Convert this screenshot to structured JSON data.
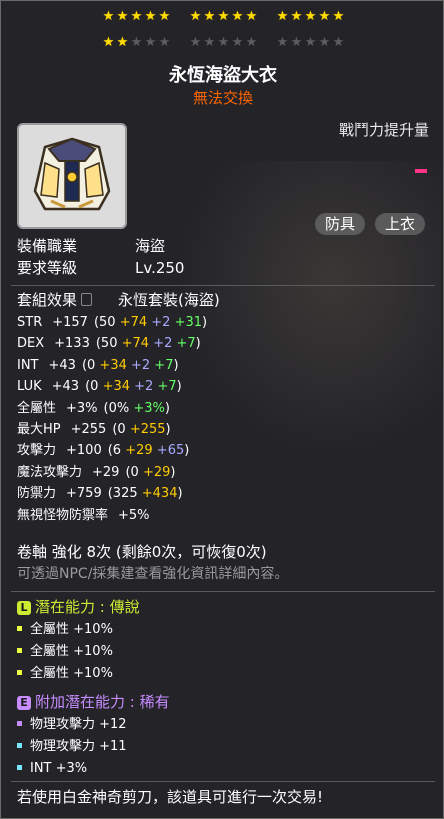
{
  "stars": {
    "rows": [
      [
        5,
        5,
        5
      ],
      [
        2,
        0,
        0
      ]
    ],
    "per_group": 5
  },
  "item": {
    "name": "永恆海盜大衣",
    "trade_status": "無法交換"
  },
  "power": {
    "label": "戰鬥力提升量"
  },
  "tags": [
    "防具",
    "上衣"
  ],
  "requirements": [
    {
      "label": "裝備職業",
      "value": "海盜"
    },
    {
      "label": "要求等級",
      "value": "Lv.250"
    }
  ],
  "set_effect": {
    "label": "套組效果",
    "value": "永恆套裝(海盜)"
  },
  "stats": [
    {
      "name": "STR",
      "total": "+157",
      "parts": [
        {
          "text": "(50 ",
          "c": ""
        },
        {
          "text": "+74 ",
          "c": "yellow"
        },
        {
          "text": "+2 ",
          "c": "purple"
        },
        {
          "text": "+31",
          "c": "green"
        },
        {
          "text": ")",
          "c": ""
        }
      ]
    },
    {
      "name": "DEX",
      "total": "+133",
      "parts": [
        {
          "text": "(50 ",
          "c": ""
        },
        {
          "text": "+74 ",
          "c": "yellow"
        },
        {
          "text": "+2 ",
          "c": "purple"
        },
        {
          "text": "+7",
          "c": "green"
        },
        {
          "text": ")",
          "c": ""
        }
      ]
    },
    {
      "name": "INT",
      "total": "+43",
      "parts": [
        {
          "text": "(0 ",
          "c": ""
        },
        {
          "text": "+34 ",
          "c": "yellow"
        },
        {
          "text": "+2 ",
          "c": "purple"
        },
        {
          "text": "+7",
          "c": "green"
        },
        {
          "text": ")",
          "c": ""
        }
      ]
    },
    {
      "name": "LUK",
      "total": "+43",
      "parts": [
        {
          "text": "(0 ",
          "c": ""
        },
        {
          "text": "+34 ",
          "c": "yellow"
        },
        {
          "text": "+2 ",
          "c": "purple"
        },
        {
          "text": "+7",
          "c": "green"
        },
        {
          "text": ")",
          "c": ""
        }
      ]
    },
    {
      "name": "全屬性",
      "total": "+3%",
      "parts": [
        {
          "text": "(0% ",
          "c": ""
        },
        {
          "text": "+3%",
          "c": "green"
        },
        {
          "text": ")",
          "c": ""
        }
      ]
    },
    {
      "name": "最大HP",
      "total": "+255",
      "parts": [
        {
          "text": "(0 ",
          "c": ""
        },
        {
          "text": "+255",
          "c": "yellow"
        },
        {
          "text": ")",
          "c": ""
        }
      ]
    },
    {
      "name": "攻擊力",
      "total": "+100",
      "parts": [
        {
          "text": "(6 ",
          "c": ""
        },
        {
          "text": "+29 ",
          "c": "yellow"
        },
        {
          "text": "+65",
          "c": "purple"
        },
        {
          "text": ")",
          "c": ""
        }
      ]
    },
    {
      "name": "魔法攻擊力",
      "total": "+29",
      "parts": [
        {
          "text": "(0 ",
          "c": ""
        },
        {
          "text": "+29",
          "c": "yellow"
        },
        {
          "text": ")",
          "c": ""
        }
      ]
    },
    {
      "name": "防禦力",
      "total": "+759",
      "parts": [
        {
          "text": "(325 ",
          "c": ""
        },
        {
          "text": "+434",
          "c": "yellow"
        },
        {
          "text": ")",
          "c": ""
        }
      ]
    },
    {
      "name": "無視怪物防禦率",
      "total": "+5%",
      "parts": []
    }
  ],
  "scroll": {
    "text": "卷軸 強化 8次 (剩餘0次，可恢復0次)",
    "hint": "可透過NPC/採集建查看強化資訊詳細內容。"
  },
  "potential": {
    "badge": "L",
    "title": "潛在能力 : 傳說",
    "lines": [
      "全屬性 +10%",
      "全屬性 +10%",
      "全屬性 +10%"
    ]
  },
  "bonus_potential": {
    "badge": "E",
    "title": "附加潛在能力 : 稀有",
    "lines": [
      "物理攻擊力 +12",
      "物理攻擊力 +11",
      "INT +3%"
    ]
  },
  "footer": "若使用白金神奇剪刀，該道具可進行一次交易!"
}
